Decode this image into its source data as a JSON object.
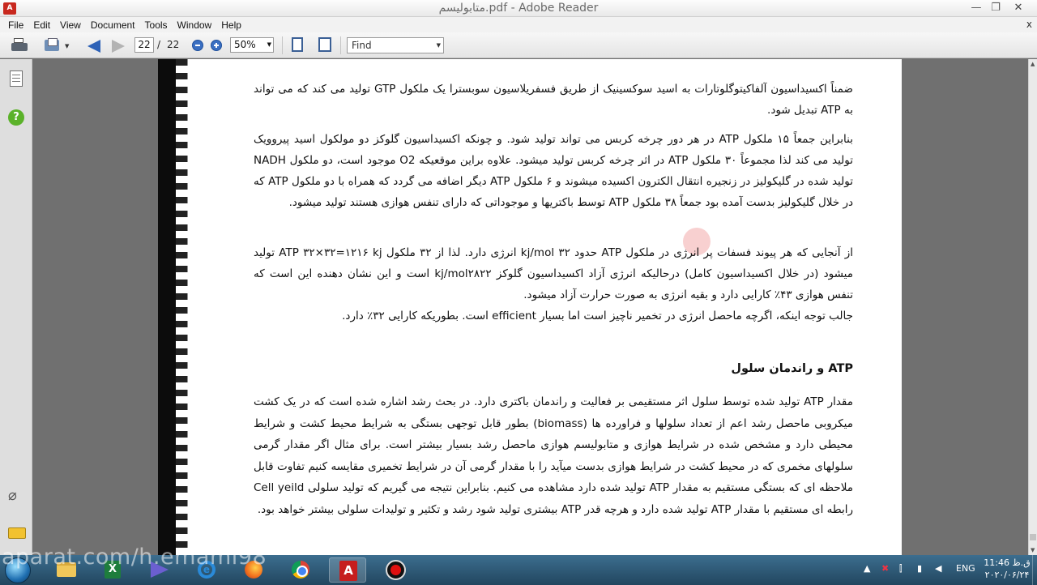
{
  "window": {
    "title": "متابولیسم.pdf - Adobe Reader",
    "controls": {
      "minimize": "—",
      "maximize": "❐",
      "close": "✕"
    }
  },
  "menu": {
    "items": [
      "File",
      "Edit",
      "View",
      "Document",
      "Tools",
      "Window",
      "Help"
    ],
    "close": "x"
  },
  "toolbar": {
    "current_page": "22",
    "page_separator": "/",
    "total_pages": "22",
    "zoom": "50%",
    "find_placeholder": "Find"
  },
  "document": {
    "p1": "ضمناً اکسیداسیون آلفاکیتوگلوتارات به اسید سوکسینیک از طریق فسفریلاسیون سوبسترا یک ملکول GTP تولید می کند که می تواند به ATP تبدیل شود.",
    "p2": "بنابراین جمعاً ۱۵ ملکول ATP در هر دور چرخه کربس می تواند تولید شود. و چونکه اکسیداسیون گلوکز دو مولکول اسید پیروویک تولید می کند لذا مجموعاً ۳۰ ملکول ATP در اثر چرخه کربس تولید میشود. علاوه براین موقعیکه O2 موجود است، دو ملکول NADH تولید شده در گلیکولیز در زنجیره انتقال الکترون اکسیده میشوند و ۶ ملکول ATP دیگر اضافه می گردد که همراه با دو ملکول ATP که در خلال گلیکولیز بدست آمده بود جمعاً ۳۸ ملکول ATP توسط باکتریها و موجوداتی که دارای تنفس هوازی هستند تولید میشود.",
    "p3": "از آنجایی که هر پیوند فسفات پر انرژی در ملکول ATP حدود ۳۲ kj/mol انرژی دارد. لذا از ۳۲ ملکول ATP ۳۲×۳۲=۱۲۱۶ kj تولید میشود (در خلال اکسیداسیون کامل) درحالیکه انرژی آزاد اکسیداسیون گلوکز kj/mol۲۸۲۲ است و این نشان دهنده این است که تنفس هوازی ۴۳٪ کارایی دارد و بقیه انرژی به صورت حرارت آزاد میشود.",
    "p4": "جالب توجه اینکه، اگرچه ماحصل انرژی در تخمیر ناچیز است اما بسیار efficient است. بطوریکه کارایی ۳۲٪ دارد.",
    "heading": "ATP و راندمان سلول",
    "p5": "مقدار ATP تولید شده توسط سلول اثر مستقیمی بر فعالیت و راندمان باکتری دارد. در بحث رشد اشاره شده است که در یک کشت میکروبی ماحصل رشد اعم از تعداد سلولها و فراورده ها (biomass) بطور قابل توجهی بستگی به شرایط محیط کشت و شرایط محیطی دارد و مشخص شده در شرایط هوازی و متابولیسم هوازی ماحصل رشد بسیار بیشتر است. برای مثال اگر مقدار گرمی سلولهای مخمری که در محیط کشت در شرایط هوازی بدست میآید را با مقدار گرمی آن در شرایط تخمیری مقایسه کنیم تفاوت قابل ملاحظه ای که بستگی مستقیم به مقدار ATP تولید شده دارد مشاهده می کنیم. بنابراین نتیجه می گیریم که تولید سلولی Cell yeild رابطه ای مستقیم با مقدار ATP تولید شده دارد و هرچه قدر ATP بیشتری تولید شود رشد و تکثیر و تولیدات سلولی بیشتر خواهد بود."
  },
  "taskbar": {
    "watermark": "aparat.com/h.emami98",
    "language": "ENG",
    "time": "11:46 ق.ظ",
    "date": "۲۰۲۰/۰۶/۲۴"
  }
}
